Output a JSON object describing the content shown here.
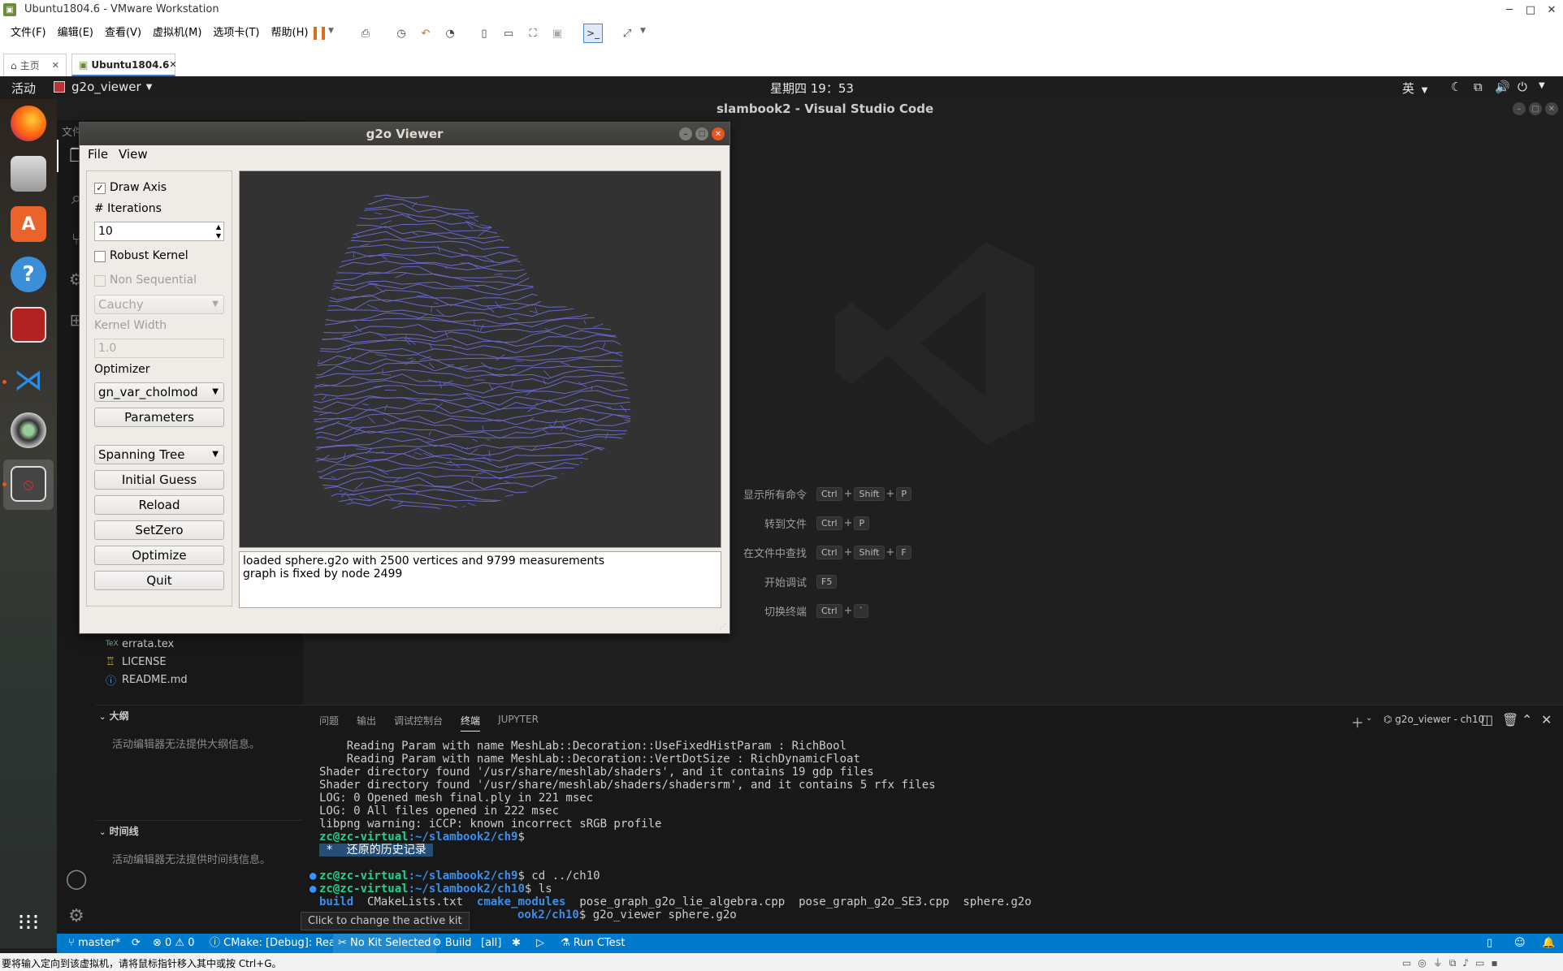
{
  "vmware": {
    "title": "Ubuntu1804.6 - VMware Workstation",
    "menu": [
      "文件(F)",
      "编辑(E)",
      "查看(V)",
      "虚拟机(M)",
      "选项卡(T)",
      "帮助(H)"
    ],
    "tabs": [
      {
        "label": "主页"
      },
      {
        "label": "Ubuntu1804.6"
      }
    ],
    "status_text": "要将输入定向到该虚拟机，请将鼠标指针移入其中或按 Ctrl+G。"
  },
  "ubuntu": {
    "activities": "活动",
    "app_menu": "g2o_viewer",
    "clock": "星期四 19：53",
    "input_method": "英"
  },
  "vscode": {
    "title": "slambook2 - Visual Studio Code",
    "explorer_header_partial": "文件",
    "explorer_files": [
      {
        "icon": "TeX",
        "name": "errata.tex"
      },
      {
        "icon": "license-icon",
        "name": "LICENSE"
      },
      {
        "icon": "info-icon",
        "name": "README.md"
      }
    ],
    "outline": {
      "title": "大纲",
      "empty": "活动编辑器无法提供大纲信息。"
    },
    "timeline": {
      "title": "时间线",
      "empty": "活动编辑器无法提供时间线信息。"
    },
    "welcome_shortcuts": [
      {
        "label": "显示所有命令",
        "keys": [
          "Ctrl",
          "+",
          "Shift",
          "+",
          "P"
        ]
      },
      {
        "label": "转到文件",
        "keys": [
          "Ctrl",
          "+",
          "P"
        ]
      },
      {
        "label": "在文件中查找",
        "keys": [
          "Ctrl",
          "+",
          "Shift",
          "+",
          "F"
        ]
      },
      {
        "label": "开始调试",
        "keys": [
          "F5"
        ]
      },
      {
        "label": "切换终端",
        "keys": [
          "Ctrl",
          "+",
          "`"
        ]
      }
    ],
    "panel_tabs": [
      "问题",
      "输出",
      "调试控制台",
      "终端",
      "JUPYTER"
    ],
    "active_panel_tab": "终端",
    "terminal_name": "g2o_viewer - ch10",
    "terminal_lines": [
      "    Reading Param with name MeshLab::Decoration::UseFixedHistParam : RichBool",
      "    Reading Param with name MeshLab::Decoration::VertDotSize : RichDynamicFloat",
      "Shader directory found '/usr/share/meshlab/shaders', and it contains 19 gdp files",
      "Shader directory found '/usr/share/meshlab/shaders/shadersrm', and it contains 5 rfx files",
      "LOG: 0 Opened mesh final.ply in 221 msec",
      "LOG: 0 All files opened in 222 msec",
      "libpng warning: iCCP: known incorrect sRGB profile"
    ],
    "prompt1": {
      "user": "zc@zc-virtual",
      "path": ":~/slambook2/ch9",
      "cmd": "$"
    },
    "restored_history": " *  还原的历史记录 ",
    "prompt2": {
      "user": "zc@zc-virtual",
      "path": ":~/slambook2/ch9",
      "cmd": "$ cd ../ch10"
    },
    "prompt3": {
      "user": "zc@zc-virtual",
      "path": ":~/slambook2/ch10",
      "cmd": "$ ls"
    },
    "ls_output": {
      "dirs": [
        "build",
        "cmake_modules"
      ],
      "files": [
        "CMakeLists.txt",
        "pose_graph_g2o_lie_algebra.cpp",
        "pose_graph_g2o_SE3.cpp",
        "sphere.g2o"
      ]
    },
    "prompt4": {
      "user_partial": "",
      "path": "ook2/ch10",
      "cmd": "$ g2o_viewer sphere.g2o"
    },
    "tooltip": "Click to change the active kit",
    "status": {
      "branch": "master*",
      "problems": "⊗ 0 ⚠ 0",
      "cmake": "CMake: [Debug]: Ready",
      "kit": "No Kit Selected",
      "build": "Build",
      "target": "[all]",
      "ctest": "Run CTest"
    }
  },
  "g2o_viewer": {
    "title": "g2o Viewer",
    "menu": [
      "File",
      "View"
    ],
    "draw_axis": {
      "label": "Draw Axis",
      "checked": true
    },
    "iterations": {
      "label": "# Iterations",
      "value": "10"
    },
    "robust_kernel": {
      "label": "Robust Kernel",
      "checked": false
    },
    "non_sequential": {
      "label": "Non Sequential",
      "checked": false
    },
    "kernel_combo": "Cauchy",
    "kernel_width": {
      "label": "Kernel Width",
      "value": "1.0"
    },
    "optimizer": {
      "label": "Optimizer",
      "value": "gn_var_cholmod"
    },
    "parameters_btn": "Parameters",
    "init_combo": "Spanning Tree",
    "buttons": [
      "Initial Guess",
      "Reload",
      "SetZero",
      "Optimize",
      "Quit"
    ],
    "log": [
      "loaded sphere.g2o with 2500 vertices and 9799 measurements",
      "graph is fixed by node 2499"
    ],
    "mesh_color": "#6a67c9"
  }
}
